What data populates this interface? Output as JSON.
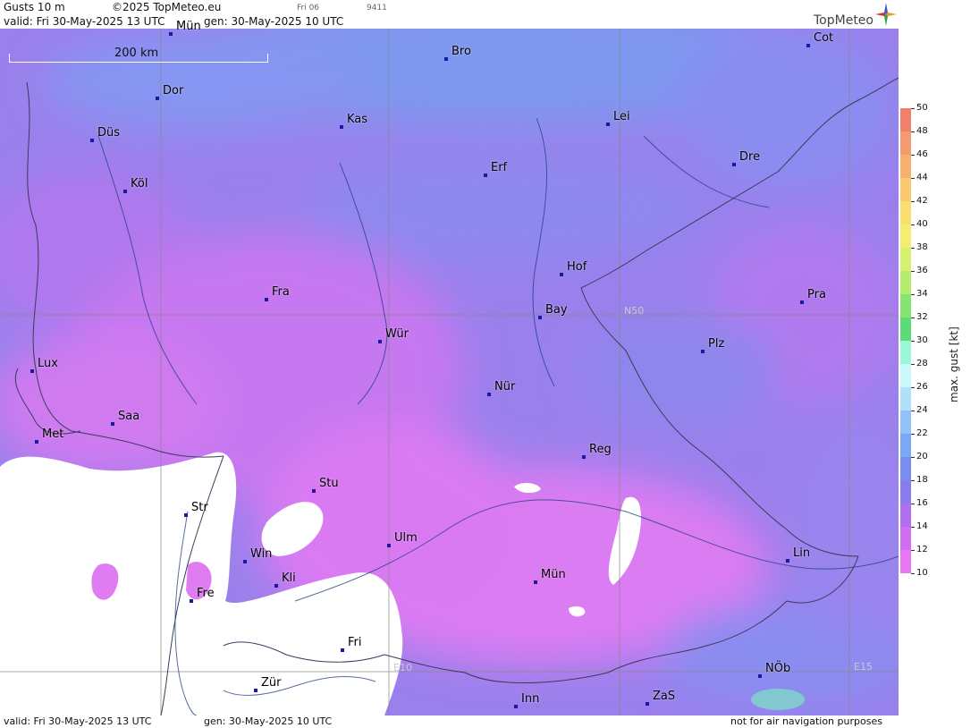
{
  "header": {
    "param": "Gusts 10 m",
    "copyright": "©2025 TopMeteo.eu",
    "small_day": "Fri 06",
    "small_code": "9411",
    "valid": "valid:  Fri  30-May-2025  13 UTC",
    "gen": "gen:  30-May-2025 10 UTC",
    "brand": "TopMeteo"
  },
  "footer": {
    "valid": "valid:  Fri  30-May-2025  13 UTC",
    "gen": "gen:  30-May-2025 10 UTC",
    "note": "not for air navigation purposes"
  },
  "map": {
    "scale_label": "200 km",
    "grid_labels": {
      "n50": "N50",
      "e10": "E10",
      "e15": "E15"
    },
    "cities": [
      {
        "name": "Mün_top",
        "label": "Mün"
      },
      {
        "name": "Bro",
        "label": "Bro"
      },
      {
        "name": "Cot",
        "label": "Cot"
      },
      {
        "name": "Dor",
        "label": "Dor"
      },
      {
        "name": "Kas",
        "label": "Kas"
      },
      {
        "name": "Lei",
        "label": "Lei"
      },
      {
        "name": "Düs",
        "label": "Düs"
      },
      {
        "name": "Erf",
        "label": "Erf"
      },
      {
        "name": "Dre",
        "label": "Dre"
      },
      {
        "name": "Köl",
        "label": "Köl"
      },
      {
        "name": "Hof",
        "label": "Hof"
      },
      {
        "name": "Fra",
        "label": "Fra"
      },
      {
        "name": "Pra",
        "label": "Pra"
      },
      {
        "name": "Bay",
        "label": "Bay"
      },
      {
        "name": "Wür",
        "label": "Wür"
      },
      {
        "name": "Plz",
        "label": "Plz"
      },
      {
        "name": "Lux",
        "label": "Lux"
      },
      {
        "name": "Nür",
        "label": "Nür"
      },
      {
        "name": "Saa",
        "label": "Saa"
      },
      {
        "name": "Met",
        "label": "Met"
      },
      {
        "name": "Reg",
        "label": "Reg"
      },
      {
        "name": "Stu",
        "label": "Stu"
      },
      {
        "name": "Str",
        "label": "Str"
      },
      {
        "name": "Ulm",
        "label": "Ulm"
      },
      {
        "name": "Win",
        "label": "Win"
      },
      {
        "name": "Lin",
        "label": "Lin"
      },
      {
        "name": "Kli",
        "label": "Kli"
      },
      {
        "name": "Mün",
        "label": "Mün"
      },
      {
        "name": "Fre",
        "label": "Fre"
      },
      {
        "name": "Fri",
        "label": "Fri"
      },
      {
        "name": "Zür",
        "label": "Zür"
      },
      {
        "name": "NÖb",
        "label": "NÖb"
      },
      {
        "name": "Inn",
        "label": "Inn"
      },
      {
        "name": "ZaS",
        "label": "ZaS"
      }
    ]
  },
  "legend": {
    "title": "max. gust  [kt]",
    "ticks": [
      "50",
      "48",
      "46",
      "44",
      "42",
      "40",
      "38",
      "36",
      "34",
      "32",
      "30",
      "28",
      "26",
      "24",
      "22",
      "20",
      "18",
      "16",
      "14",
      "12",
      "10"
    ],
    "colors": [
      "#f0806a",
      "#f49a70",
      "#f7b070",
      "#fac870",
      "#fbde70",
      "#f4ee70",
      "#d8f070",
      "#b4ec70",
      "#88e470",
      "#5cdc78",
      "#9cf6d8",
      "#c8f8f8",
      "#b0e0fa",
      "#90c4f8",
      "#7aa8f4",
      "#7a8cf0",
      "#8a7cec",
      "#b070ee",
      "#d070f0",
      "#e878f4"
    ],
    "colors_note": "bands from top (50) down to 12"
  }
}
